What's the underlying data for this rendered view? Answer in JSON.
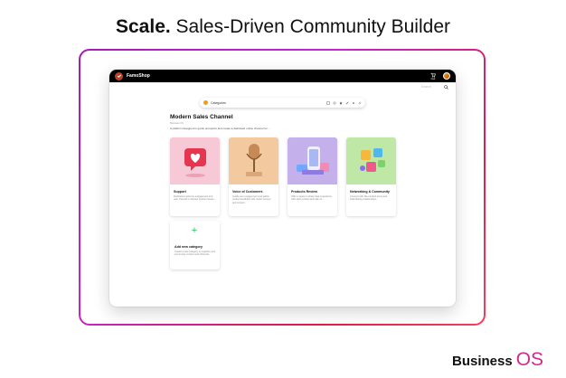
{
  "headline": {
    "bold": "Scale.",
    "rest": " Sales-Driven Community Builder"
  },
  "app": {
    "brand": "FamoShop",
    "cart_label": "Cart",
    "search_placeholder": "Search"
  },
  "category_bar": {
    "label": "Categories",
    "tools": [
      "image-icon",
      "gear-icon",
      "star-icon",
      "edit-icon",
      "settings-icon",
      "link-icon"
    ]
  },
  "section": {
    "title": "Modern Sales Channel",
    "subtitle": "Business OS",
    "description": "A platform designed to guide prospects and create a dedicated online channel for ..."
  },
  "cards": [
    {
      "title": "Support",
      "description": "Dedicated customer engagement and user channel to discuss product issues..."
    },
    {
      "title": "Voice of Customers",
      "description": "Guide user engagement and gather product feedback with useful surveys and content..."
    },
    {
      "title": "Products Review",
      "description": "Offer a space to share their experience with each product and rate on..."
    },
    {
      "title": "Networking & Community",
      "description": "Connect with like-minded users and build lasting relationships..."
    }
  ],
  "add_card": {
    "title": "Add new category",
    "description": "Create a new category to organize your community content and channels..."
  },
  "footer": {
    "business": "Business",
    "os": "OS"
  }
}
